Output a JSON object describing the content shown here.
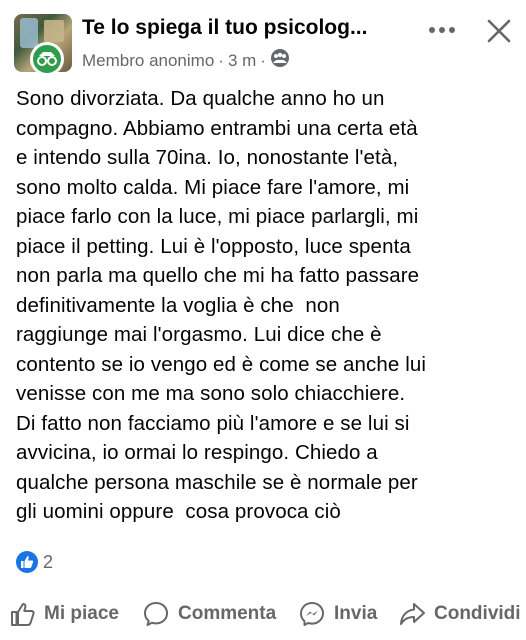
{
  "header": {
    "group_title": "Te lo spiega il tuo psicolog...",
    "author": "Membro anonimo",
    "time": "3 m",
    "separator": "·",
    "privacy_icon": "group-privacy-icon"
  },
  "post": {
    "text": "Sono divorziata. Da qualche anno ho un\ncompagno. Abbiamo entrambi una certa età\ne intendo sulla 70ina. Io, nonostante l'età,\nsono molto calda. Mi piace fare l'amore, mi\npiace farlo con la luce, mi piace parlargli, mi\npiace il petting. Lui è l'opposto, luce spenta\nnon parla ma quello che mi ha fatto passare\ndefinitivamente la voglia è che  non\nraggiunge mai l'orgasmo. Lui dice che è\ncontento se io vengo ed è come se anche lui\nvenisse con me ma sono solo chiacchiere.\nDi fatto non facciamo più l'amore e se lui si\navvicina, io ormai lo respingo. Chiedo a\nqualche persona maschile se è normale per\ngli uomini oppure  cosa provoca ciò"
  },
  "reactions": {
    "count": "2",
    "icon": "like-reaction-icon"
  },
  "actions": {
    "like": "Mi piace",
    "comment": "Commenta",
    "send": "Invia",
    "share": "Condividi"
  },
  "colors": {
    "text": "#050505",
    "secondary": "#65676b",
    "like_blue": "#1b74e4",
    "anon_green": "#2e9e4a"
  }
}
